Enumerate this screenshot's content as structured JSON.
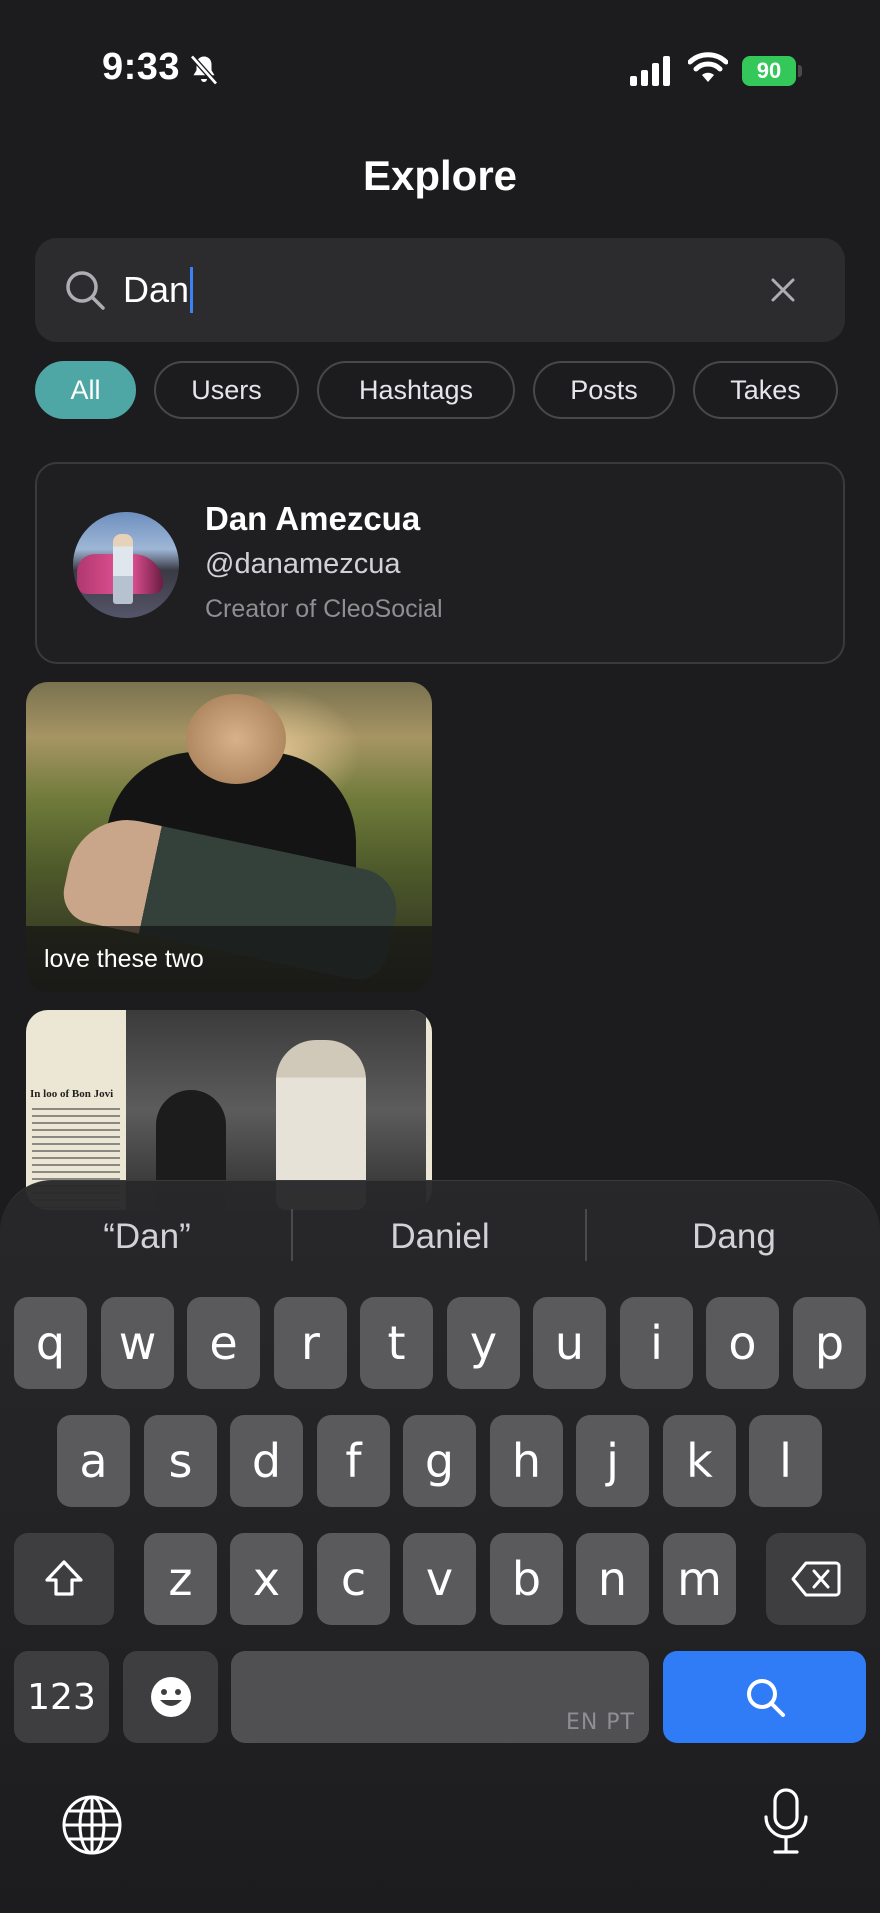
{
  "status_bar": {
    "time": "9:33",
    "battery": "90"
  },
  "header": {
    "title": "Explore"
  },
  "search": {
    "query": "Dan"
  },
  "tabs": [
    {
      "label": "All"
    },
    {
      "label": "Users"
    },
    {
      "label": "Hashtags"
    },
    {
      "label": "Posts"
    },
    {
      "label": "Takes"
    }
  ],
  "user_result": {
    "name": "Dan Amezcua",
    "handle": "@danamezcua",
    "bio": "Creator of CleoSocial"
  },
  "posts": [
    {
      "caption": "love these two"
    },
    {
      "headline": "In loo of Bon Jovi"
    }
  ],
  "keyboard": {
    "suggestions": [
      "“Dan”",
      "Daniel",
      "Dang"
    ],
    "row1": [
      "q",
      "w",
      "e",
      "r",
      "t",
      "y",
      "u",
      "i",
      "o",
      "p"
    ],
    "row2": [
      "a",
      "s",
      "d",
      "f",
      "g",
      "h",
      "j",
      "k",
      "l"
    ],
    "row3": [
      "z",
      "x",
      "c",
      "v",
      "b",
      "n",
      "m"
    ],
    "numbers_label": "123",
    "language_label": "EN PT"
  },
  "colors": {
    "accent": "#4ea7a4",
    "search_key": "#2f7cf6",
    "battery": "#34c759"
  }
}
